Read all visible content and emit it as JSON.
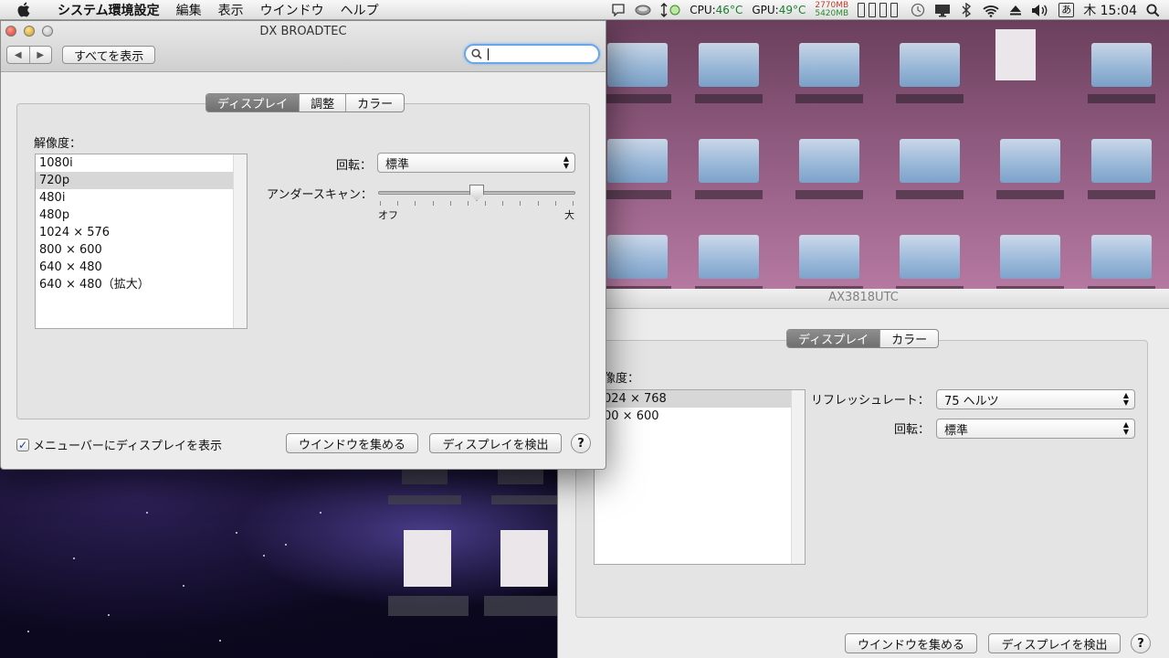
{
  "menubar": {
    "items": [
      "システム環境設定",
      "編集",
      "表示",
      "ウインドウ",
      "ヘルプ"
    ],
    "cpu_label": "CPU:",
    "cpu_value": "46°C",
    "gpu_label": "GPU:",
    "gpu_value": "49°C",
    "mem_used": "2770MB",
    "mem_free": "5420MB",
    "input_method": "あ",
    "clock": "木 15:04"
  },
  "window_front": {
    "title": "DX BROADTEC",
    "show_all": "すべてを表示",
    "search": {
      "value": "",
      "placeholder": ""
    },
    "tabs": [
      {
        "label": "ディスプレイ",
        "active": true
      },
      {
        "label": "調整",
        "active": false
      },
      {
        "label": "カラー",
        "active": false
      }
    ],
    "resolution_label": "解像度：",
    "resolutions": [
      {
        "label": "1080i",
        "selected": false
      },
      {
        "label": "720p",
        "selected": true
      },
      {
        "label": "480i",
        "selected": false
      },
      {
        "label": "480p",
        "selected": false
      },
      {
        "label": "1024 × 576",
        "selected": false
      },
      {
        "label": "800 × 600",
        "selected": false
      },
      {
        "label": "640 × 480",
        "selected": false
      },
      {
        "label": "640 × 480（拡大）",
        "selected": false
      }
    ],
    "rotation_label": "回転：",
    "rotation_value": "標準",
    "underscan_label": "アンダースキャン：",
    "underscan_min": "オフ",
    "underscan_max": "大",
    "underscan_level": 0.5,
    "show_in_menubar_label": "メニューバーにディスプレイを表示",
    "show_in_menubar_checked": true,
    "gather_windows": "ウインドウを集める",
    "detect_displays": "ディスプレイを検出",
    "help": "?"
  },
  "window_back": {
    "title": "AX3818UTC",
    "tabs": [
      {
        "label": "ディスプレイ",
        "active": true
      },
      {
        "label": "カラー",
        "active": false
      }
    ],
    "resolution_label": "像度：",
    "resolutions": [
      {
        "label": "024 × 768",
        "selected": true
      },
      {
        "label": "00 × 600",
        "selected": false
      }
    ],
    "refresh_label": "リフレッシュレート：",
    "refresh_value": "75 ヘルツ",
    "rotation_label": "回転：",
    "rotation_value": "標準",
    "gather_windows": "ウインドウを集める",
    "detect_displays": "ディスプレイを検出",
    "help": "?"
  }
}
